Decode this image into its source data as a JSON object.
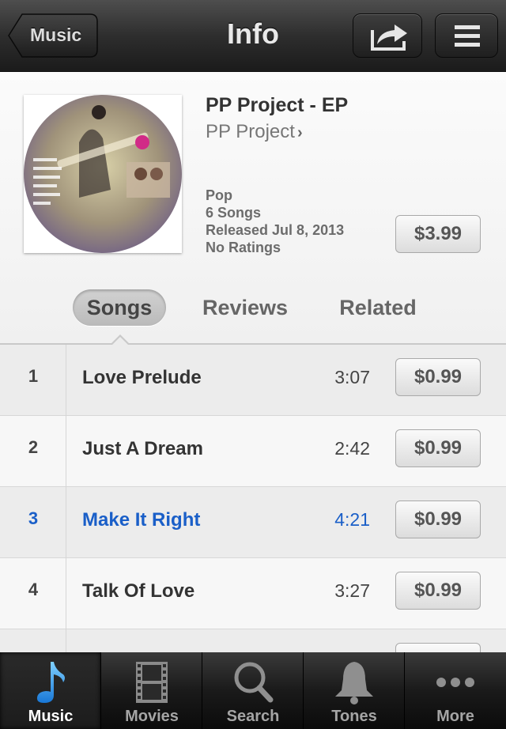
{
  "navbar": {
    "back_label": "Music",
    "title": "Info"
  },
  "album": {
    "title": "PP Project - EP",
    "artist": "PP Project",
    "genre": "Pop",
    "song_count": "6 Songs",
    "released": "Released Jul 8, 2013",
    "ratings": "No Ratings",
    "price": "$3.99"
  },
  "segments": {
    "songs": "Songs",
    "reviews": "Reviews",
    "related": "Related"
  },
  "tracks": [
    {
      "num": "1",
      "name": "Love Prelude",
      "duration": "3:07",
      "price": "$0.99"
    },
    {
      "num": "2",
      "name": "Just A Dream",
      "duration": "2:42",
      "price": "$0.99"
    },
    {
      "num": "3",
      "name": "Make It Right",
      "duration": "4:21",
      "price": "$0.99"
    },
    {
      "num": "4",
      "name": "Talk Of Love",
      "duration": "3:27",
      "price": "$0.99"
    }
  ],
  "tabbar": {
    "music": "Music",
    "movies": "Movies",
    "search": "Search",
    "tones": "Tones",
    "more": "More"
  },
  "colors": {
    "active_track": "#1a5fc8",
    "nav_dark": "#1b1b1b",
    "tab_selected_icon": "#2fa3ef"
  },
  "icons": [
    "share-icon",
    "menu-icon",
    "music-note-icon",
    "film-icon",
    "search-icon",
    "bell-icon",
    "more-dots-icon",
    "chevron-right-icon"
  ]
}
